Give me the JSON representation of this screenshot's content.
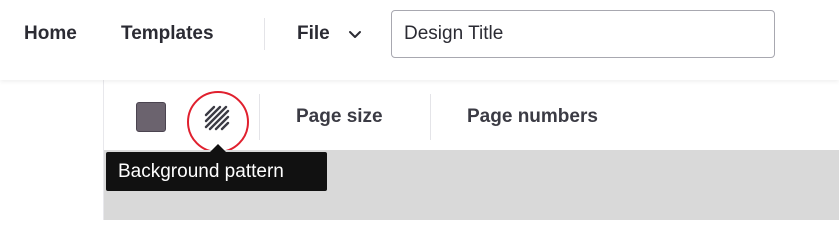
{
  "header": {
    "nav": {
      "home_label": "Home",
      "templates_label": "Templates"
    },
    "file_menu": {
      "label": "File",
      "icon": "chevron-down-icon"
    },
    "title_input": {
      "value": "Design Title"
    }
  },
  "toolbar": {
    "background_color": {
      "icon": "color-swatch",
      "color": "#6b636e"
    },
    "background_pattern": {
      "icon": "diagonal-stripes-icon",
      "highlight_color": "#e0202e"
    },
    "page_size_label": "Page size",
    "page_numbers_label": "Page numbers"
  },
  "tooltip": {
    "text": "Background pattern"
  },
  "colors": {
    "canvas": "#d9d9d9",
    "tooltip_bg": "#111111",
    "text": "#2b2b33"
  }
}
